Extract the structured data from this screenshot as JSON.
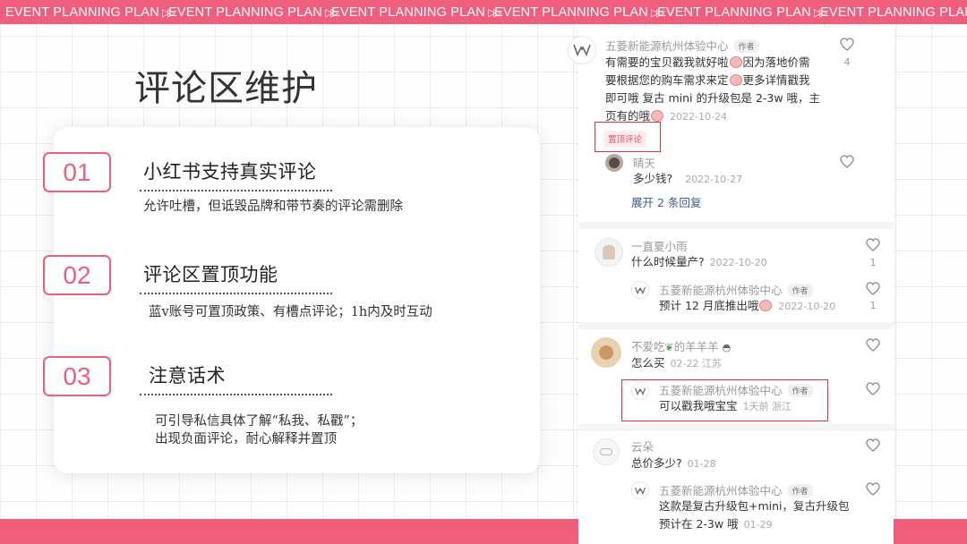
{
  "banner": {
    "items": [
      "EVENT PLANNING PLAN",
      "EVENT PLANNING PLAN",
      "EVENT PLANNING PLAN",
      "EVENT PLANNING PLAN",
      "EVENT PLANNING PLAN",
      "EVENT PLANNING PLAN"
    ],
    "arrow": "▷▷",
    "color": "#ef5f7c"
  },
  "title": "评论区维护",
  "points": [
    {
      "num": "01",
      "heading": "小红书支持真实评论",
      "desc": "允许吐槽，但诋毁品牌和带节奏的评论需删除"
    },
    {
      "num": "02",
      "heading": "评论区置顶功能",
      "desc": "蓝v账号可置顶政策、有槽点评论；1h内及时互动"
    },
    {
      "num": "03",
      "heading": "注意话术",
      "desc_lines": [
        "可引导私信具体了解“私我、私戳”；",
        "出现负面评论，耐心解释并置顶"
      ]
    }
  ],
  "comments": {
    "c1": {
      "user": "五菱新能源杭州体验中心",
      "tag": "作者",
      "line1": "有需要的宝贝戳我就好啦",
      "line1b": "因为落地价需",
      "line2": "要根据您的购车需求来定",
      "line2b": "更多详情戳我",
      "line3": "即可哦   复古 mini 的升级包是 2-3w 哦，主",
      "line4": "页有的哦",
      "time": "2022-10-24",
      "likes": "4",
      "pin": "置顶评论"
    },
    "c1r": {
      "user": "晴天",
      "text": "多少钱?",
      "time": "2022-10-27",
      "expand": "展开 2 条回复"
    },
    "c2": {
      "user": "一直夏小雨",
      "text": "什么时候量产?",
      "time": "2022-10-20",
      "likes": "1"
    },
    "c2r": {
      "user": "五菱新能源杭州体验中心",
      "tag": "作者",
      "text": "预计 12 月底推出哦",
      "time": "2022-10-20",
      "likes": "1"
    },
    "c3": {
      "user_a": "不爱吃",
      "user_b": "的羊羊羊",
      "text": "怎么买",
      "time": "02-22 江苏"
    },
    "c3r": {
      "user": "五菱新能源杭州体验中心",
      "tag": "作者",
      "text": "可以戳我哦宝宝",
      "time": "1天前 浙江"
    },
    "c4": {
      "user": "云朵",
      "text": "总价多少?",
      "time": "01-28"
    },
    "c4r": {
      "user": "五菱新能源杭州体验中心",
      "tag": "作者",
      "line1": "这款是复古升级包+mini，复古升级包",
      "line2": "预计在 2-3w 哦",
      "time": "01-29"
    }
  }
}
